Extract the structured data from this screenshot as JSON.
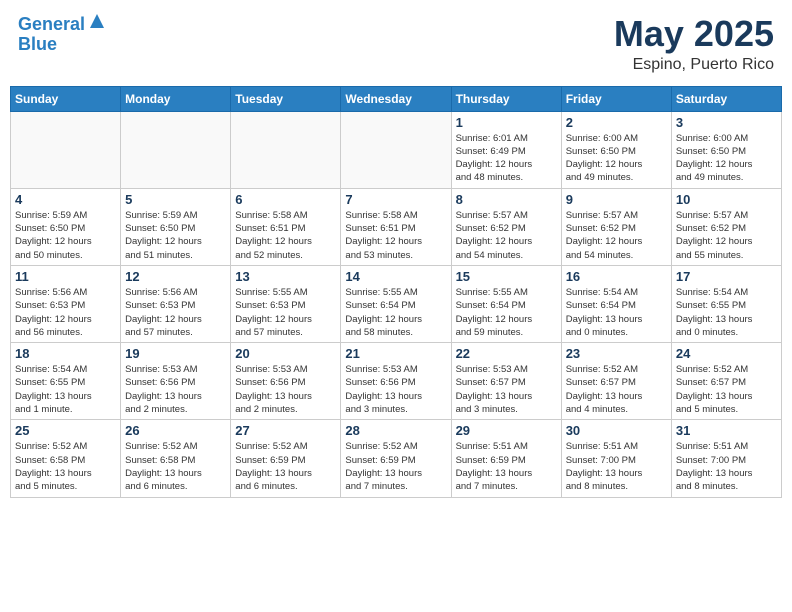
{
  "header": {
    "logo_line1": "General",
    "logo_line2": "Blue",
    "month": "May 2025",
    "location": "Espino, Puerto Rico"
  },
  "weekdays": [
    "Sunday",
    "Monday",
    "Tuesday",
    "Wednesday",
    "Thursday",
    "Friday",
    "Saturday"
  ],
  "weeks": [
    [
      {
        "day": "",
        "info": ""
      },
      {
        "day": "",
        "info": ""
      },
      {
        "day": "",
        "info": ""
      },
      {
        "day": "",
        "info": ""
      },
      {
        "day": "1",
        "info": "Sunrise: 6:01 AM\nSunset: 6:49 PM\nDaylight: 12 hours\nand 48 minutes."
      },
      {
        "day": "2",
        "info": "Sunrise: 6:00 AM\nSunset: 6:50 PM\nDaylight: 12 hours\nand 49 minutes."
      },
      {
        "day": "3",
        "info": "Sunrise: 6:00 AM\nSunset: 6:50 PM\nDaylight: 12 hours\nand 49 minutes."
      }
    ],
    [
      {
        "day": "4",
        "info": "Sunrise: 5:59 AM\nSunset: 6:50 PM\nDaylight: 12 hours\nand 50 minutes."
      },
      {
        "day": "5",
        "info": "Sunrise: 5:59 AM\nSunset: 6:50 PM\nDaylight: 12 hours\nand 51 minutes."
      },
      {
        "day": "6",
        "info": "Sunrise: 5:58 AM\nSunset: 6:51 PM\nDaylight: 12 hours\nand 52 minutes."
      },
      {
        "day": "7",
        "info": "Sunrise: 5:58 AM\nSunset: 6:51 PM\nDaylight: 12 hours\nand 53 minutes."
      },
      {
        "day": "8",
        "info": "Sunrise: 5:57 AM\nSunset: 6:52 PM\nDaylight: 12 hours\nand 54 minutes."
      },
      {
        "day": "9",
        "info": "Sunrise: 5:57 AM\nSunset: 6:52 PM\nDaylight: 12 hours\nand 54 minutes."
      },
      {
        "day": "10",
        "info": "Sunrise: 5:57 AM\nSunset: 6:52 PM\nDaylight: 12 hours\nand 55 minutes."
      }
    ],
    [
      {
        "day": "11",
        "info": "Sunrise: 5:56 AM\nSunset: 6:53 PM\nDaylight: 12 hours\nand 56 minutes."
      },
      {
        "day": "12",
        "info": "Sunrise: 5:56 AM\nSunset: 6:53 PM\nDaylight: 12 hours\nand 57 minutes."
      },
      {
        "day": "13",
        "info": "Sunrise: 5:55 AM\nSunset: 6:53 PM\nDaylight: 12 hours\nand 57 minutes."
      },
      {
        "day": "14",
        "info": "Sunrise: 5:55 AM\nSunset: 6:54 PM\nDaylight: 12 hours\nand 58 minutes."
      },
      {
        "day": "15",
        "info": "Sunrise: 5:55 AM\nSunset: 6:54 PM\nDaylight: 12 hours\nand 59 minutes."
      },
      {
        "day": "16",
        "info": "Sunrise: 5:54 AM\nSunset: 6:54 PM\nDaylight: 13 hours\nand 0 minutes."
      },
      {
        "day": "17",
        "info": "Sunrise: 5:54 AM\nSunset: 6:55 PM\nDaylight: 13 hours\nand 0 minutes."
      }
    ],
    [
      {
        "day": "18",
        "info": "Sunrise: 5:54 AM\nSunset: 6:55 PM\nDaylight: 13 hours\nand 1 minute."
      },
      {
        "day": "19",
        "info": "Sunrise: 5:53 AM\nSunset: 6:56 PM\nDaylight: 13 hours\nand 2 minutes."
      },
      {
        "day": "20",
        "info": "Sunrise: 5:53 AM\nSunset: 6:56 PM\nDaylight: 13 hours\nand 2 minutes."
      },
      {
        "day": "21",
        "info": "Sunrise: 5:53 AM\nSunset: 6:56 PM\nDaylight: 13 hours\nand 3 minutes."
      },
      {
        "day": "22",
        "info": "Sunrise: 5:53 AM\nSunset: 6:57 PM\nDaylight: 13 hours\nand 3 minutes."
      },
      {
        "day": "23",
        "info": "Sunrise: 5:52 AM\nSunset: 6:57 PM\nDaylight: 13 hours\nand 4 minutes."
      },
      {
        "day": "24",
        "info": "Sunrise: 5:52 AM\nSunset: 6:57 PM\nDaylight: 13 hours\nand 5 minutes."
      }
    ],
    [
      {
        "day": "25",
        "info": "Sunrise: 5:52 AM\nSunset: 6:58 PM\nDaylight: 13 hours\nand 5 minutes."
      },
      {
        "day": "26",
        "info": "Sunrise: 5:52 AM\nSunset: 6:58 PM\nDaylight: 13 hours\nand 6 minutes."
      },
      {
        "day": "27",
        "info": "Sunrise: 5:52 AM\nSunset: 6:59 PM\nDaylight: 13 hours\nand 6 minutes."
      },
      {
        "day": "28",
        "info": "Sunrise: 5:52 AM\nSunset: 6:59 PM\nDaylight: 13 hours\nand 7 minutes."
      },
      {
        "day": "29",
        "info": "Sunrise: 5:51 AM\nSunset: 6:59 PM\nDaylight: 13 hours\nand 7 minutes."
      },
      {
        "day": "30",
        "info": "Sunrise: 5:51 AM\nSunset: 7:00 PM\nDaylight: 13 hours\nand 8 minutes."
      },
      {
        "day": "31",
        "info": "Sunrise: 5:51 AM\nSunset: 7:00 PM\nDaylight: 13 hours\nand 8 minutes."
      }
    ]
  ]
}
